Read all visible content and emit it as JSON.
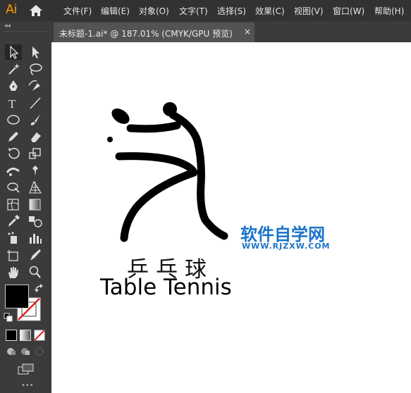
{
  "app": {
    "logo": "Ai",
    "home_icon": "home-icon",
    "accent": "#ff9a00"
  },
  "menu": [
    "文件(F)",
    "编辑(E)",
    "对象(O)",
    "文字(T)",
    "选择(S)",
    "效果(C)",
    "视图(V)",
    "窗口(W)",
    "帮助(H)"
  ],
  "toolbar": {
    "grip": "◂◂",
    "tools": [
      "selection-tool",
      "direct-selection-tool",
      "magic-wand-tool",
      "lasso-tool",
      "pen-tool",
      "curvature-tool",
      "type-tool",
      "line-tool",
      "ellipse-tool",
      "paintbrush-tool",
      "pencil-tool",
      "eraser-tool",
      "rotate-tool",
      "scale-tool",
      "width-tool",
      "puppet-warp-tool",
      "shape-builder-tool",
      "perspective-grid-tool",
      "mesh-tool",
      "gradient-tool",
      "eyedropper-tool",
      "blend-tool",
      "symbol-sprayer-tool",
      "column-graph-tool",
      "artboard-tool",
      "slice-tool",
      "hand-tool",
      "zoom-tool"
    ],
    "fill_color": "#000000",
    "stroke": "none"
  },
  "tab": {
    "title": "未标题-1.ai* @ 187.01% (CMYK/GPU 预览)",
    "close": "×"
  },
  "artwork": {
    "chinese": "乒乓球",
    "english": "Table Tennis"
  },
  "watermark": {
    "line1": "软件自学网",
    "line2": "WWW.RJZXW.COM",
    "color": "#1a73c9"
  }
}
